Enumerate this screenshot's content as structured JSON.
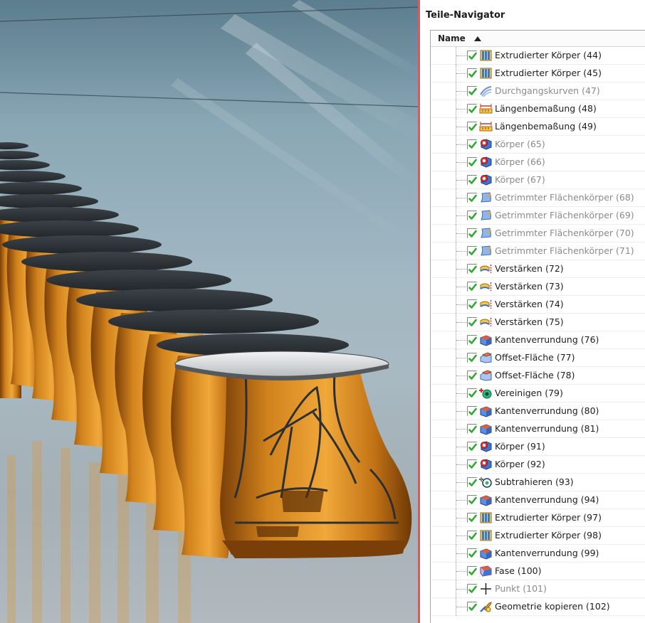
{
  "navigator": {
    "title": "Teile-Navigator",
    "column_name": "Name",
    "sort": "ascending"
  },
  "colors": {
    "accent_splitter": "#d85a5a",
    "check_green": "#2fa82f",
    "body_orange": "#d98a1e",
    "dimmed_text": "#8a8a8a"
  },
  "features": [
    {
      "label": "Extrudierter Körper (44)",
      "icon": "extrude-icon",
      "dimmed": false
    },
    {
      "label": "Extrudierter Körper (45)",
      "icon": "extrude-icon",
      "dimmed": false
    },
    {
      "label": "Durchgangskurven (47)",
      "icon": "through-curves-icon",
      "dimmed": true
    },
    {
      "label": "Längenbemaßung (48)",
      "icon": "length-dimension-icon",
      "dimmed": false
    },
    {
      "label": "Längenbemaßung (49)",
      "icon": "length-dimension-icon",
      "dimmed": false
    },
    {
      "label": "Körper (65)",
      "icon": "body-icon",
      "dimmed": true
    },
    {
      "label": "Körper (66)",
      "icon": "body-icon",
      "dimmed": true
    },
    {
      "label": "Körper (67)",
      "icon": "body-icon",
      "dimmed": true
    },
    {
      "label": "Getrimmter Flächenkörper (68)",
      "icon": "trimmed-sheet-icon",
      "dimmed": true
    },
    {
      "label": "Getrimmter Flächenkörper (69)",
      "icon": "trimmed-sheet-icon",
      "dimmed": true
    },
    {
      "label": "Getrimmter Flächenkörper (70)",
      "icon": "trimmed-sheet-icon",
      "dimmed": true
    },
    {
      "label": "Getrimmter Flächenkörper (71)",
      "icon": "trimmed-sheet-icon",
      "dimmed": true
    },
    {
      "label": "Verstärken (72)",
      "icon": "thicken-icon",
      "dimmed": false
    },
    {
      "label": "Verstärken (73)",
      "icon": "thicken-icon",
      "dimmed": false
    },
    {
      "label": "Verstärken (74)",
      "icon": "thicken-icon",
      "dimmed": false
    },
    {
      "label": "Verstärken (75)",
      "icon": "thicken-icon",
      "dimmed": false
    },
    {
      "label": "Kantenverrundung (76)",
      "icon": "edge-blend-icon",
      "dimmed": false
    },
    {
      "label": "Offset-Fläche (77)",
      "icon": "offset-face-icon",
      "dimmed": false
    },
    {
      "label": "Offset-Fläche (78)",
      "icon": "offset-face-icon",
      "dimmed": false
    },
    {
      "label": "Vereinigen (79)",
      "icon": "unite-icon",
      "dimmed": false
    },
    {
      "label": "Kantenverrundung (80)",
      "icon": "edge-blend-icon",
      "dimmed": false
    },
    {
      "label": "Kantenverrundung (81)",
      "icon": "edge-blend-icon",
      "dimmed": false
    },
    {
      "label": "Körper (91)",
      "icon": "body-icon",
      "dimmed": false
    },
    {
      "label": "Körper (92)",
      "icon": "body-icon",
      "dimmed": false
    },
    {
      "label": "Subtrahieren (93)",
      "icon": "subtract-icon",
      "dimmed": false
    },
    {
      "label": "Kantenverrundung (94)",
      "icon": "edge-blend-icon",
      "dimmed": false
    },
    {
      "label": "Extrudierter Körper (97)",
      "icon": "extrude-icon",
      "dimmed": false
    },
    {
      "label": "Extrudierter Körper (98)",
      "icon": "extrude-icon",
      "dimmed": false
    },
    {
      "label": "Kantenverrundung (99)",
      "icon": "edge-blend-icon",
      "dimmed": false
    },
    {
      "label": "Fase (100)",
      "icon": "chamfer-icon",
      "dimmed": false
    },
    {
      "label": "Punkt (101)",
      "icon": "point-icon",
      "dimmed": true
    },
    {
      "label": "Geometrie kopieren (102)",
      "icon": "copy-geometry-icon",
      "dimmed": false
    }
  ]
}
